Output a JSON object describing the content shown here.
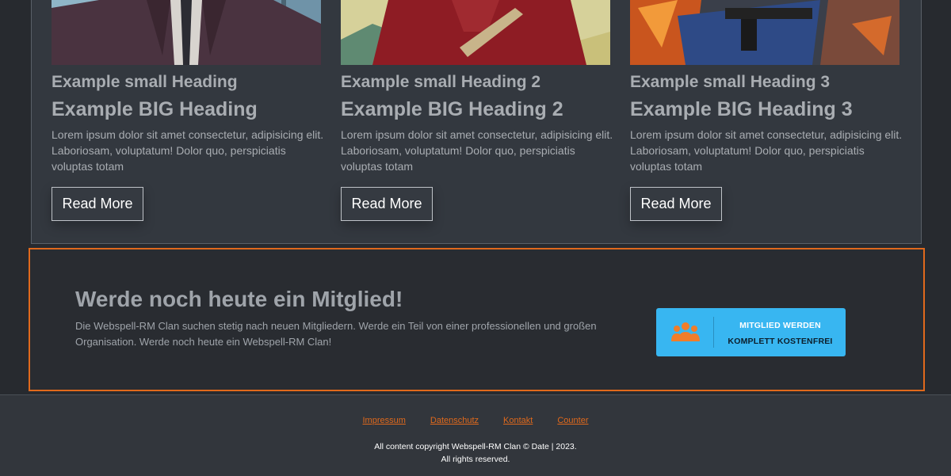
{
  "cards": [
    {
      "image_alt": "man-in-suit-image",
      "small_heading": "Example small Heading",
      "big_heading": "Example BIG Heading",
      "text": "Lorem ipsum dolor sit amet consectetur, adipisicing elit. Laboriosam, voluptatum! Dolor quo, perspiciatis voluptas totam",
      "button": "Read More"
    },
    {
      "image_alt": "man-in-red-shirt-image",
      "small_heading": "Example small Heading 2",
      "big_heading": "Example BIG Heading 2",
      "text": "Lorem ipsum dolor sit amet consectetur, adipisicing elit. Laboriosam, voluptatum! Dolor quo, perspiciatis voluptas totam",
      "button": "Read More"
    },
    {
      "image_alt": "man-with-rifle-image",
      "small_heading": "Example small Heading 3",
      "big_heading": "Example BIG Heading 3",
      "text": "Lorem ipsum dolor sit amet consectetur, adipisicing elit. Laboriosam, voluptatum! Dolor quo, perspiciatis voluptas totam",
      "button": "Read More"
    }
  ],
  "cta": {
    "title": "Werde noch heute ein Mitglied!",
    "text": "Die Webspell-RM Clan suchen stetig nach neuen Mitgliedern. Werde ein Teil von einer professionellen und großen Organisation. Werde noch heute ein Webspell-RM Clan!",
    "button_line1": "MITGLIED WERDEN",
    "button_line2": "KOMPLETT KOSTENFREI",
    "button_icon": "group-icon",
    "button_color": "#38b6f1",
    "border_color": "#e0691c"
  },
  "footer": {
    "links": [
      "Impressum",
      "Datenschutz",
      "Kontakt",
      "Counter"
    ],
    "copyright_line1": "All content copyright Webspell-RM Clan © Date | 2023.",
    "copyright_line2": "All rights reserved."
  }
}
